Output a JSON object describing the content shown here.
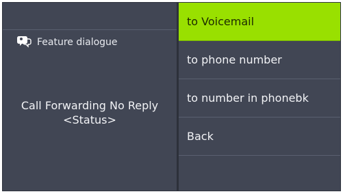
{
  "left_panel": {
    "feature_label": "Feature dialogue",
    "status_line1": "Call Forwarding No Reply",
    "status_line2": "<Status>"
  },
  "menu": {
    "items": [
      {
        "label": "to Voicemail",
        "selected": true
      },
      {
        "label": "to phone number",
        "selected": false
      },
      {
        "label": "to number in phonebk",
        "selected": false
      },
      {
        "label": "Back",
        "selected": false
      },
      {
        "label": "",
        "selected": false
      }
    ]
  },
  "colors": {
    "background": "#414654",
    "selected": "#99e000",
    "divider": "#5a6070",
    "text": "#f2f3f6"
  },
  "icons": {
    "feature": "feature-dialogue-icon"
  }
}
